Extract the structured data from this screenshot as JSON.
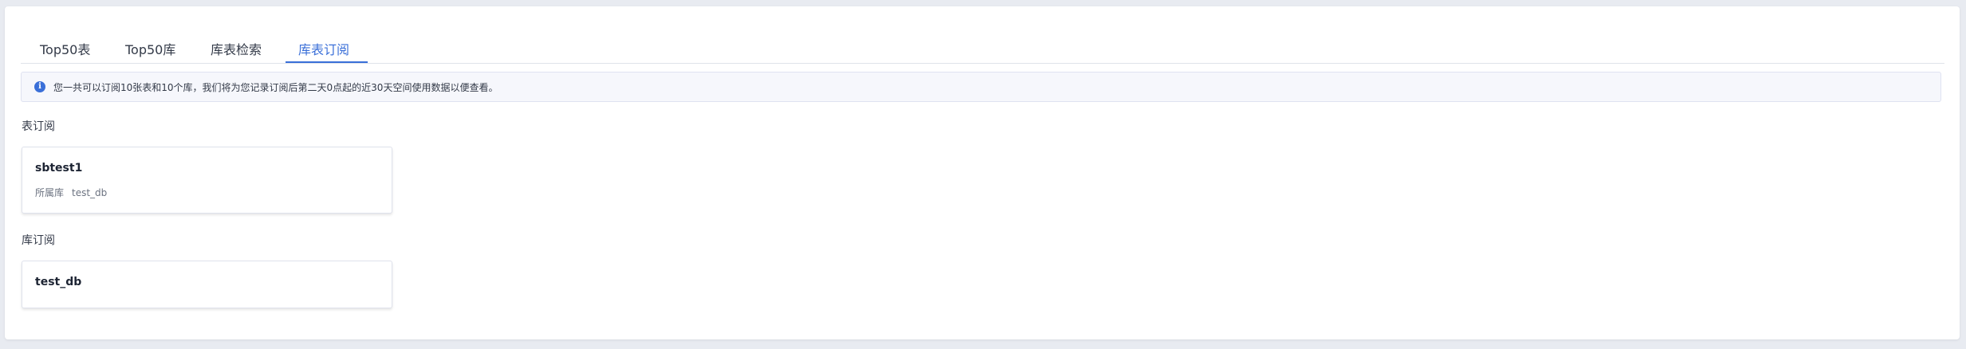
{
  "tabs": [
    {
      "label": "Top50表",
      "active": false
    },
    {
      "label": "Top50库",
      "active": false
    },
    {
      "label": "库表检索",
      "active": false
    },
    {
      "label": "库表订阅",
      "active": true
    }
  ],
  "notice": {
    "icon": "info-icon",
    "icon_glyph": "i",
    "text": "您一共可以订阅10张表和10个库，我们将为您记录订阅后第二天0点起的近30天空间使用数据以便查看。"
  },
  "table_subscriptions": {
    "title": "表订阅",
    "items": [
      {
        "name": "sbtest1",
        "db_label": "所属库",
        "db_value": "test_db"
      }
    ]
  },
  "db_subscriptions": {
    "title": "库订阅",
    "items": [
      {
        "name": "test_db"
      }
    ]
  },
  "colors": {
    "accent": "#3a6fd8",
    "background": "#e8ebf1",
    "panel": "#ffffff",
    "notice_bg": "#f6f7fc"
  }
}
